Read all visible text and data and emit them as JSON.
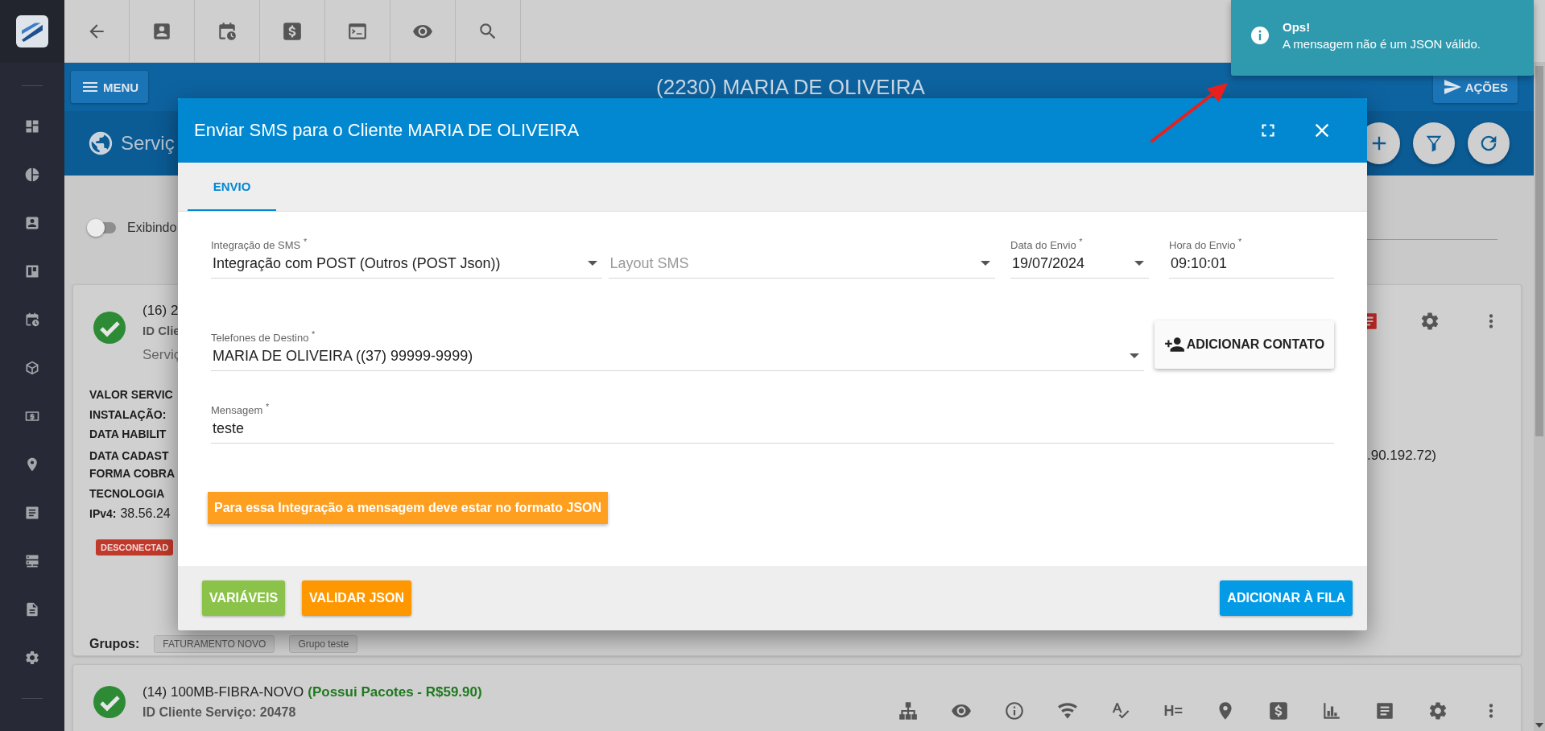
{
  "header": {
    "menu_button": "MENU",
    "title": "(2230) MARIA DE OLIVEIRA",
    "actions_button": "AÇÕES"
  },
  "page_title": "Serviç",
  "toggle": {
    "label": "Exibindo",
    "on": false
  },
  "cards": [
    {
      "heading": "(16) 2",
      "client_id": "ID Clie",
      "service": "Serviç",
      "details": [
        {
          "label": "VALOR SERVIC"
        },
        {
          "label": "INSTALAÇÃO:"
        },
        {
          "label": "DATA HABILIT"
        },
        {
          "label": "DATA CADAST",
          "tail": ".90.192.72)"
        },
        {
          "label": "FORMA COBRA"
        },
        {
          "label": "TECNOLOGIA"
        },
        {
          "label": "IPv4:",
          "value": "38.56.24"
        }
      ],
      "status": "DESCONECTAD",
      "groups_label": "Grupos:",
      "groups": [
        "FATURAMENTO NOVO",
        "Grupo teste"
      ]
    },
    {
      "heading": "(14) 100MB-FIBRA-NOVO",
      "package": "(Possui Pacotes - R$59.90)",
      "client_id": "ID Cliente Serviço: 20478",
      "action_text": "H="
    }
  ],
  "modal": {
    "title": "Enviar SMS para o Cliente MARIA DE OLIVEIRA",
    "tabs": [
      {
        "label": "ENVIO",
        "selected": true
      }
    ],
    "fields": [
      {
        "kind": "select",
        "label": "Integração de SMS $^{*}$",
        "value": "Integração com POST (Outros (POST Json))"
      },
      {
        "kind": "select",
        "placeholder": "Layout SMS"
      },
      {
        "kind": "select",
        "label": "Data do Envio $^{*}$",
        "value": "19/07/2024"
      },
      {
        "kind": "text",
        "label": "Hora do Envio $^{*}$",
        "value": "09:10:01"
      }
    ],
    "phones": {
      "label": "Telefones de Destino $^{*}$",
      "value": "MARIA DE OLIVEIRA ((37) 99999-9999)"
    },
    "add_contact_button": "ADICIONAR CONTATO",
    "message": {
      "label": "Mensagem $^{*}$",
      "value": "teste"
    },
    "warning": "Para essa Integração a mensagem deve estar no formato JSON",
    "footer_buttons": [
      {
        "label": "VARIÁVEIS",
        "kind": "green"
      },
      {
        "label": "VALIDAR JSON",
        "kind": "orange"
      },
      {
        "label": "ADICIONAR À FILA",
        "kind": "blue"
      }
    ]
  },
  "toast": {
    "title": "Ops!",
    "message": "A mensagem não é um JSON válido."
  }
}
